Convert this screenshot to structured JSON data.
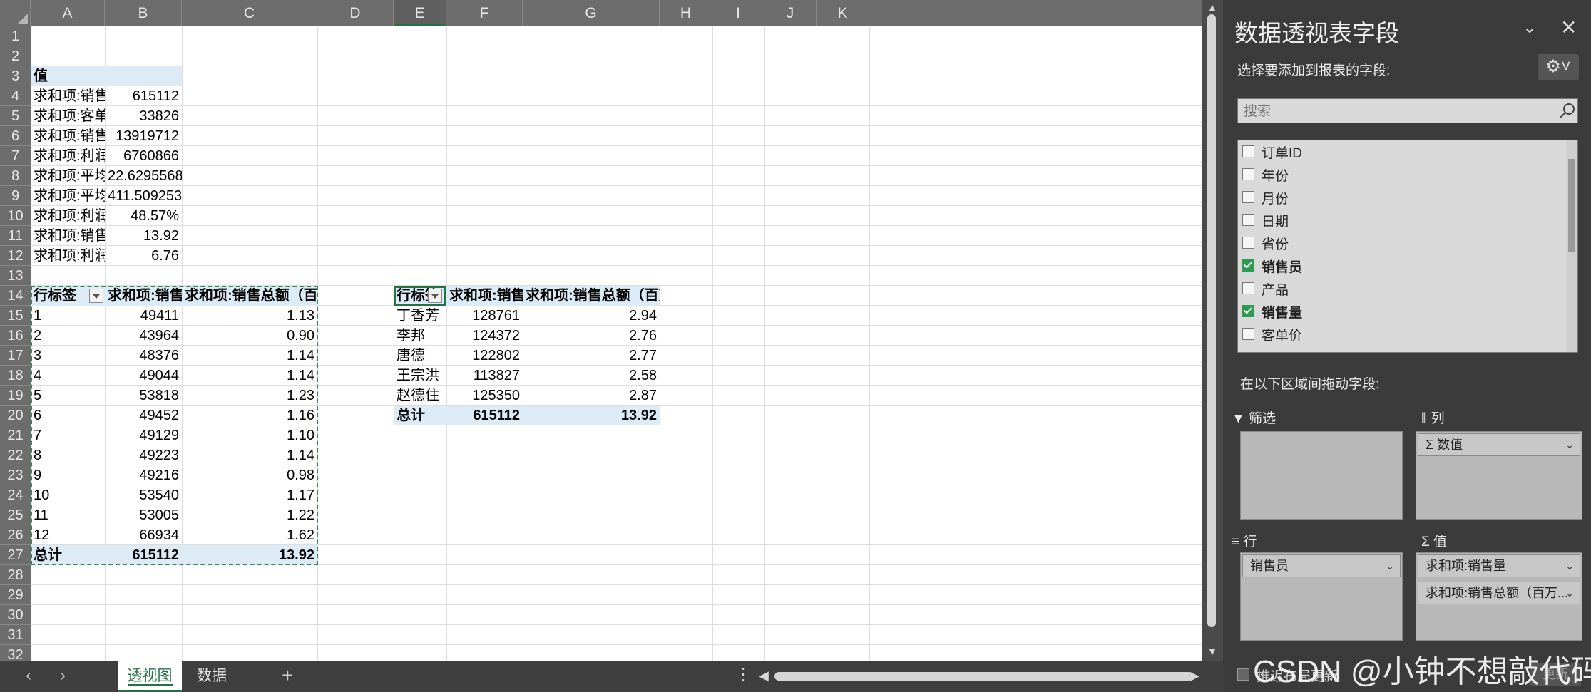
{
  "columns": [
    "A",
    "B",
    "C",
    "D",
    "E",
    "F",
    "G",
    "H",
    "I",
    "J",
    "K"
  ],
  "rows": [
    "1",
    "2",
    "3",
    "4",
    "5",
    "6",
    "7",
    "8",
    "9",
    "10",
    "11",
    "12",
    "13",
    "14",
    "15",
    "16",
    "17",
    "18",
    "19",
    "20",
    "21",
    "22",
    "23",
    "24",
    "25",
    "26",
    "27",
    "28",
    "29",
    "30",
    "31",
    "32"
  ],
  "values_block": {
    "header": "值",
    "rows": [
      {
        "label": "求和项:销售",
        "value": "615112"
      },
      {
        "label": "求和项:客单",
        "value": "33826"
      },
      {
        "label": "求和项:销售",
        "value": "13919712"
      },
      {
        "label": "求和项:利润",
        "value": "6760866"
      },
      {
        "label": "求和项:平均",
        "value": "22.62955689"
      },
      {
        "label": "求和项:平均",
        "value": "411.5092532"
      },
      {
        "label": "求和项:利润",
        "value": "48.57%"
      },
      {
        "label": "求和项:销售",
        "value": "13.92"
      },
      {
        "label": "求和项:利润",
        "value": "6.76"
      }
    ]
  },
  "pivot_month": {
    "headers": [
      "行标签",
      "求和项:销售量",
      "求和项:销售总额（百万）"
    ],
    "rows": [
      [
        "1",
        "49411",
        "1.13"
      ],
      [
        "2",
        "43964",
        "0.90"
      ],
      [
        "3",
        "48376",
        "1.14"
      ],
      [
        "4",
        "49044",
        "1.14"
      ],
      [
        "5",
        "53818",
        "1.23"
      ],
      [
        "6",
        "49452",
        "1.16"
      ],
      [
        "7",
        "49129",
        "1.10"
      ],
      [
        "8",
        "49223",
        "1.14"
      ],
      [
        "9",
        "49216",
        "0.98"
      ],
      [
        "10",
        "53540",
        "1.17"
      ],
      [
        "11",
        "53005",
        "1.22"
      ],
      [
        "12",
        "66934",
        "1.62"
      ]
    ],
    "total": [
      "总计",
      "615112",
      "13.92"
    ]
  },
  "pivot_seller": {
    "headers": [
      "行标签",
      "求和项:销售量",
      "求和项:销售总额（百万）"
    ],
    "rows": [
      [
        "丁香芳",
        "128761",
        "2.94"
      ],
      [
        "李邦",
        "124372",
        "2.76"
      ],
      [
        "唐德",
        "122802",
        "2.77"
      ],
      [
        "王宗洪",
        "113827",
        "2.58"
      ],
      [
        "赵德住",
        "125350",
        "2.87"
      ]
    ],
    "total": [
      "总计",
      "615112",
      "13.92"
    ]
  },
  "tabs": [
    {
      "label": "透视图",
      "active": true
    },
    {
      "label": "数据",
      "active": false
    }
  ],
  "add_sheet": "+",
  "tab_more": "⋮",
  "panel": {
    "title": "数据透视表字段",
    "subtitle": "选择要添加到报表的字段:",
    "search_placeholder": "搜索",
    "fields": [
      {
        "label": "订单ID",
        "checked": false
      },
      {
        "label": "年份",
        "checked": false
      },
      {
        "label": "月份",
        "checked": false
      },
      {
        "label": "日期",
        "checked": false
      },
      {
        "label": "省份",
        "checked": false
      },
      {
        "label": "销售员",
        "checked": true
      },
      {
        "label": "产品",
        "checked": false
      },
      {
        "label": "销售量",
        "checked": true
      },
      {
        "label": "客单价",
        "checked": false
      }
    ],
    "drag_hint": "在以下区域间拖动字段:",
    "zones": {
      "filter": {
        "label": "筛选",
        "items": []
      },
      "columns": {
        "label": "列",
        "items": [
          "Σ 数值"
        ]
      },
      "rows": {
        "label": "行",
        "items": [
          "销售员"
        ]
      },
      "values": {
        "label": "值",
        "items": [
          "求和项:销售量",
          "求和项:销售总额（百万..."
        ]
      }
    },
    "zone_icons": {
      "filter": "▼",
      "columns": "⦀",
      "rows": "≡",
      "values": "Σ"
    },
    "defer_label": "推迟布局更新",
    "update_label": "更新"
  },
  "watermark": "CSDN @小钟不想敲代码",
  "colors": {
    "accent": "#217346",
    "pivot_band": "#ddebf7",
    "panel_bg": "#3b3b3b",
    "check": "#2e9b52"
  }
}
